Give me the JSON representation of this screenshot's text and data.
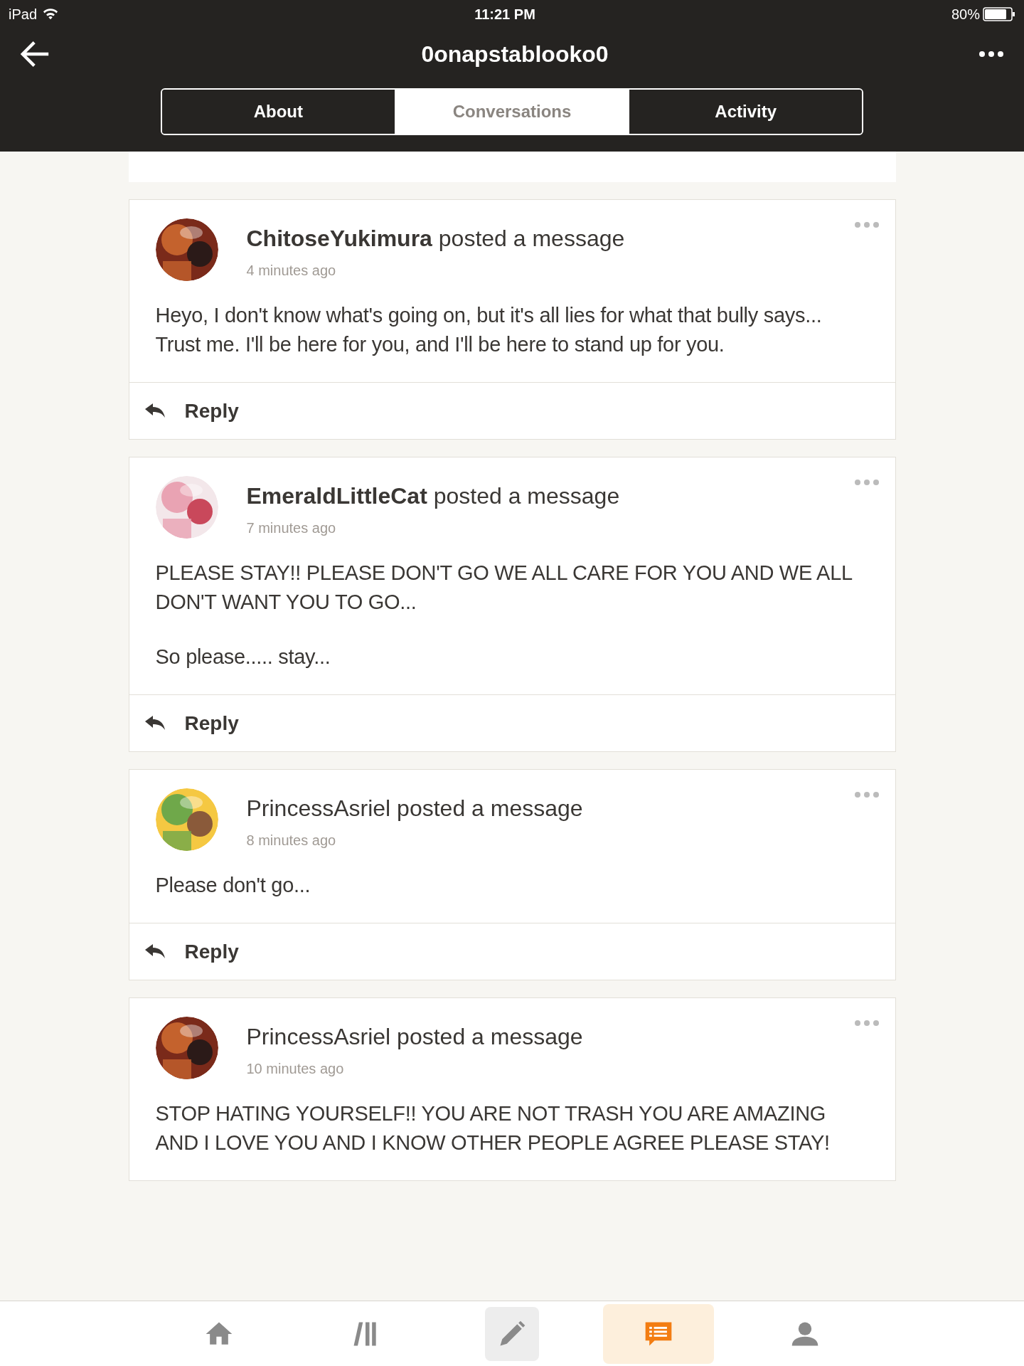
{
  "status_bar": {
    "device": "iPad",
    "time": "11:21 PM",
    "battery": "80%"
  },
  "header": {
    "title": "0onapstablooko0"
  },
  "tabs": [
    {
      "label": "About",
      "selected": false
    },
    {
      "label": "Conversations",
      "selected": true
    },
    {
      "label": "Activity",
      "selected": false
    }
  ],
  "posts": [
    {
      "title": "**ChitoseYukimura** posted a message",
      "time": "4 minutes ago",
      "paragraphs": [
        "Heyo, I don't know what's going on, but it's all lies for what that bully says... Trust me. I'll be here for you, and I'll be here to stand up for you."
      ],
      "reply": "Reply"
    },
    {
      "title": "**EmeraldLittleCat** posted a message",
      "time": "7 minutes ago",
      "paragraphs": [
        "PLEASE STAY!! PLEASE DON'T GO WE ALL CARE FOR YOU AND WE ALL DON'T WANT YOU TO GO...",
        "So please..... stay..."
      ],
      "reply": "Reply"
    },
    {
      "title": "PrincessAsriel posted a message",
      "time": "8 minutes ago",
      "paragraphs": [
        "Please don't go..."
      ],
      "reply": "Reply"
    },
    {
      "title": "PrincessAsriel posted a message",
      "time": "10 minutes ago",
      "paragraphs": [
        "STOP HATING YOURSELF!! YOU ARE NOT TRASH YOU ARE AMAZING AND I LOVE YOU AND I KNOW OTHER PEOPLE AGREE PLEASE STAY!"
      ]
    }
  ],
  "bottom_nav": [
    {
      "kind": "home",
      "selected": false
    },
    {
      "kind": "library",
      "selected": false
    },
    {
      "kind": "compose",
      "selected": false
    },
    {
      "kind": "messages",
      "selected": true
    },
    {
      "kind": "profile",
      "selected": false
    }
  ]
}
